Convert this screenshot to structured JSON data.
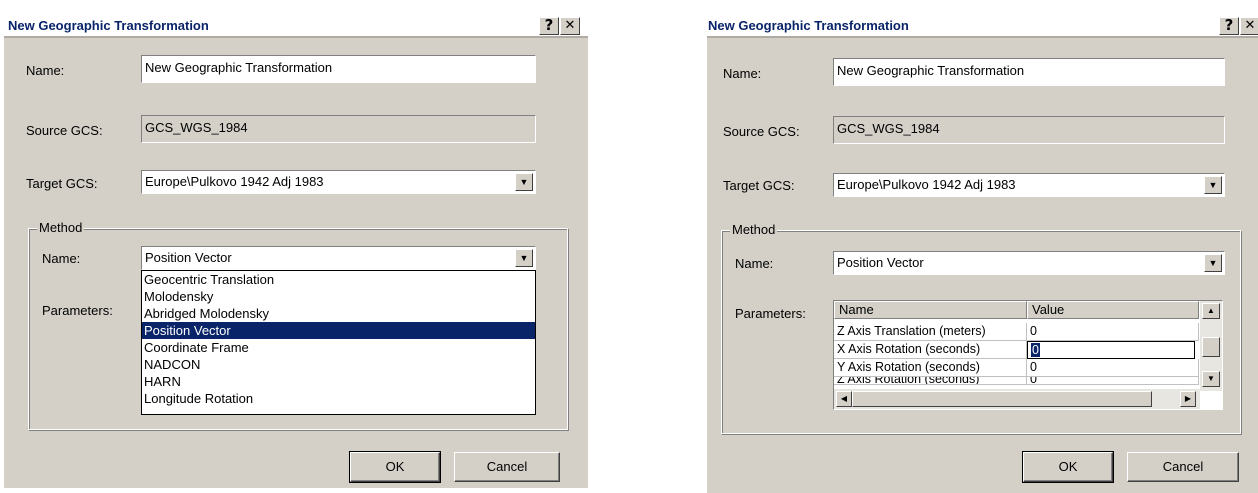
{
  "left_dialog": {
    "title": "New Geographic Transformation",
    "help_glyph": "?",
    "close_glyph": "✕",
    "name_label": "Name:",
    "name_value": "New Geographic Transformation",
    "source_label": "Source GCS:",
    "source_value": "GCS_WGS_1984",
    "target_label": "Target GCS:",
    "target_value": "Europe\\Pulkovo 1942 Adj 1983",
    "method_group": "Method",
    "method_name_label": "Name:",
    "method_name_value": "Position Vector",
    "parameters_label": "Parameters:",
    "dropdown_options": [
      "Geocentric Translation",
      "Molodensky",
      "Abridged Molodensky",
      "Position Vector",
      "Coordinate Frame",
      "NADCON",
      "HARN",
      "Longitude Rotation"
    ],
    "selected_option": "Position Vector",
    "ok": "OK",
    "cancel": "Cancel"
  },
  "right_dialog": {
    "title": "New Geographic Transformation",
    "help_glyph": "?",
    "close_glyph": "✕",
    "name_label": "Name:",
    "name_value": "New Geographic Transformation",
    "source_label": "Source GCS:",
    "source_value": "GCS_WGS_1984",
    "target_label": "Target GCS:",
    "target_value": "Europe\\Pulkovo 1942 Adj 1983",
    "method_group": "Method",
    "method_name_label": "Name:",
    "method_name_value": "Position Vector",
    "parameters_label": "Parameters:",
    "grid_headers": [
      "Name",
      "Value"
    ],
    "grid_rows": [
      {
        "name": "Z Axis Translation (meters)",
        "value": "0"
      },
      {
        "name": "X Axis Rotation (seconds)",
        "value": "0"
      },
      {
        "name": "Y Axis Rotation (seconds)",
        "value": "0"
      },
      {
        "name": "Z Axis Rotation (seconds)",
        "value": "0"
      }
    ],
    "ok": "OK",
    "cancel": "Cancel"
  },
  "colors": {
    "dialog_bg": "#d4d0c8",
    "title_text": "#0a246a",
    "selection": "#0a246a"
  },
  "icons": [
    "help-icon",
    "close-icon",
    "chevron-down-icon",
    "arrow-up-icon",
    "arrow-down-icon",
    "arrow-left-icon",
    "arrow-right-icon"
  ]
}
